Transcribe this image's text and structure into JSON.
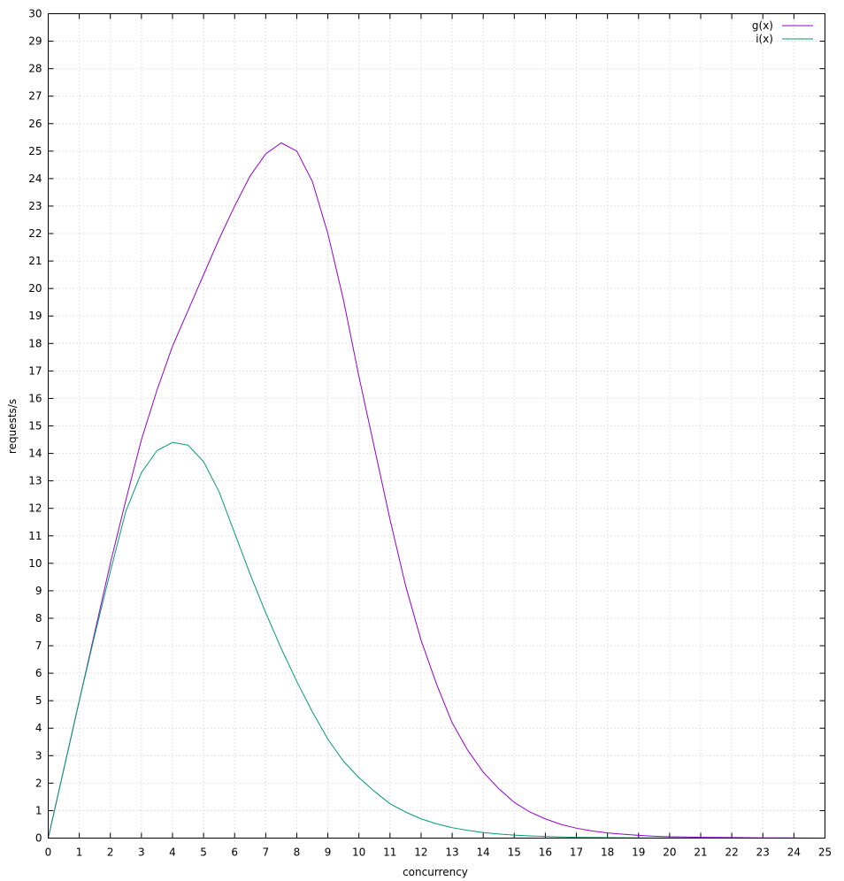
{
  "chart_data": {
    "type": "line",
    "xlabel": "concurrency",
    "ylabel": "requests/s",
    "xlim": [
      0,
      25
    ],
    "ylim": [
      0,
      30
    ],
    "xticks": [
      0,
      1,
      2,
      3,
      4,
      5,
      6,
      7,
      8,
      9,
      10,
      11,
      12,
      13,
      14,
      15,
      16,
      17,
      18,
      19,
      20,
      21,
      22,
      23,
      24,
      25
    ],
    "yticks": [
      0,
      1,
      2,
      3,
      4,
      5,
      6,
      7,
      8,
      9,
      10,
      11,
      12,
      13,
      14,
      15,
      16,
      17,
      18,
      19,
      20,
      21,
      22,
      23,
      24,
      25,
      26,
      27,
      28,
      29,
      30
    ],
    "grid": true,
    "legend_position": "top-right",
    "series": [
      {
        "name": "g(x)",
        "color": "#9400d3",
        "x": [
          0,
          0.5,
          1,
          1.5,
          2,
          2.5,
          3,
          3.5,
          4,
          4.5,
          5,
          5.5,
          6,
          6.5,
          7,
          7.5,
          8,
          8.5,
          9,
          9.5,
          10,
          10.5,
          11,
          11.5,
          12,
          12.5,
          13,
          13.5,
          14,
          14.5,
          15,
          15.5,
          16,
          16.5,
          17,
          17.5,
          18,
          18.5,
          19,
          19.5,
          20,
          21,
          22,
          23,
          24,
          25
        ],
        "y": [
          0,
          2.5,
          5.0,
          7.5,
          10.0,
          12.3,
          14.5,
          16.3,
          17.9,
          19.2,
          20.5,
          21.8,
          23.0,
          24.1,
          24.9,
          25.3,
          25.0,
          23.9,
          22.0,
          19.6,
          16.8,
          14.2,
          11.6,
          9.2,
          7.2,
          5.6,
          4.2,
          3.2,
          2.4,
          1.8,
          1.3,
          0.95,
          0.7,
          0.5,
          0.36,
          0.26,
          0.19,
          0.14,
          0.1,
          0.07,
          0.05,
          0.03,
          0.02,
          0.01,
          0.005,
          0.0
        ]
      },
      {
        "name": "i(x)",
        "color": "#009e73",
        "x": [
          0,
          0.5,
          1,
          1.5,
          2,
          2.5,
          3,
          3.5,
          4,
          4.5,
          5,
          5.5,
          6,
          6.5,
          7,
          7.5,
          8,
          8.5,
          9,
          9.5,
          10,
          10.5,
          11,
          11.5,
          12,
          12.5,
          13,
          13.5,
          14,
          14.5,
          15,
          15.5,
          16,
          16.5,
          17,
          18,
          19,
          20,
          21,
          22,
          23,
          24,
          25
        ],
        "y": [
          0,
          2.5,
          5.0,
          7.4,
          9.7,
          11.9,
          13.3,
          14.1,
          14.4,
          14.3,
          13.7,
          12.6,
          11.1,
          9.6,
          8.2,
          6.9,
          5.7,
          4.6,
          3.6,
          2.8,
          2.2,
          1.7,
          1.25,
          0.95,
          0.7,
          0.52,
          0.38,
          0.28,
          0.2,
          0.15,
          0.11,
          0.08,
          0.06,
          0.04,
          0.03,
          0.02,
          0.01,
          0.005,
          0.0,
          0.0,
          0.0,
          0.0,
          0.0
        ]
      }
    ]
  }
}
